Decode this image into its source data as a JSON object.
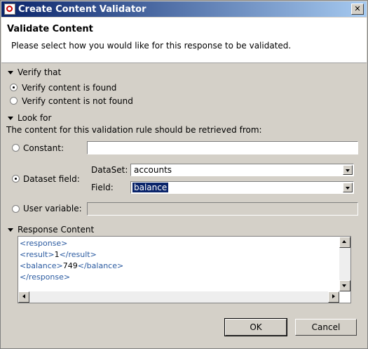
{
  "window": {
    "title": "Create Content Validator",
    "close_label": "✕"
  },
  "banner": {
    "heading": "Validate Content",
    "description": "Please select how you would like for this response to be validated."
  },
  "verify": {
    "section_label": "Verify that",
    "options": [
      "Verify content is found",
      "Verify content is not found"
    ],
    "selected_index": 0
  },
  "lookfor": {
    "section_label": "Look for",
    "description": "The content for this validation rule should be retrieved from:",
    "constant_label": "Constant:",
    "constant_value": "",
    "dataset_label": "Dataset field:",
    "dataset_selected": true,
    "dataset_combo_label": "DataSet:",
    "dataset_value": "accounts",
    "field_label": "Field:",
    "field_value": "balance",
    "uservar_label": "User variable:",
    "uservar_value": ""
  },
  "response": {
    "section_label": "Response Content",
    "lines": [
      {
        "open": "<response>",
        "text": "",
        "close": ""
      },
      {
        "open": "<result>",
        "text": "1",
        "close": "</result>"
      },
      {
        "open": "<balance>",
        "text": "749",
        "close": "</balance>"
      },
      {
        "open": "</response>",
        "text": "",
        "close": ""
      }
    ]
  },
  "buttons": {
    "ok": "OK",
    "cancel": "Cancel"
  }
}
